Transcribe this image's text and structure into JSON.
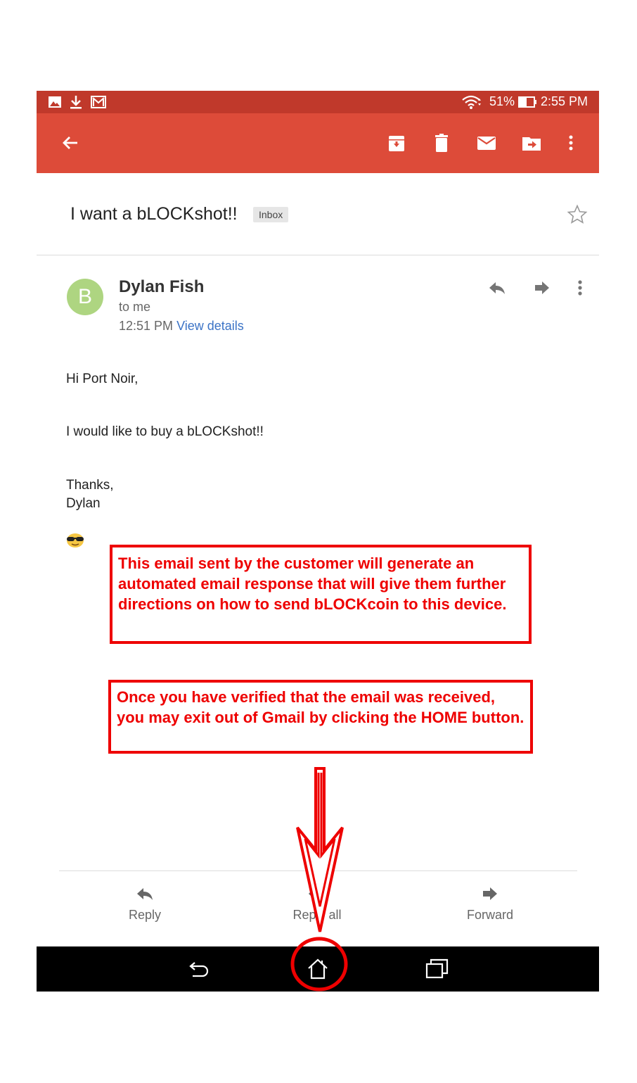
{
  "status_bar": {
    "battery": "51%",
    "time": "2:55 PM"
  },
  "email": {
    "subject": "I want a bLOCKshot!!",
    "label": "Inbox",
    "sender": {
      "initial": "B",
      "name": "Dylan Fish",
      "recipient": "to me",
      "time": "12:51 PM",
      "view_details": "View details"
    },
    "body": {
      "greeting": "Hi Port Noir,",
      "line1": "I would like to buy a bLOCKshot!!",
      "closing": "Thanks,",
      "signature": "Dylan"
    }
  },
  "annotations": {
    "note1": "This email sent by the customer will generate an automated email response that will give them further directions on how to send bLOCKcoin to this device.",
    "note2": "Once you have verified that the email was received, you may exit out of Gmail by clicking the HOME button."
  },
  "actions": {
    "reply": "Reply",
    "reply_all": "Reply all",
    "forward": "Forward"
  },
  "colors": {
    "status_bar": "#c0392b",
    "app_bar": "#dd4b39",
    "annotation": "#ee0000",
    "avatar": "#aed581",
    "link": "#3b73c6"
  },
  "icons": [
    "image-icon",
    "download-icon",
    "gmail-icon",
    "wifi-icon",
    "battery-icon",
    "back-arrow-icon",
    "archive-icon",
    "delete-icon",
    "mark-unread-icon",
    "move-to-icon",
    "more-icon",
    "star-icon",
    "reply-icon",
    "forward-icon",
    "reply-all-icon",
    "nav-back-icon",
    "nav-home-icon",
    "nav-recents-icon"
  ]
}
